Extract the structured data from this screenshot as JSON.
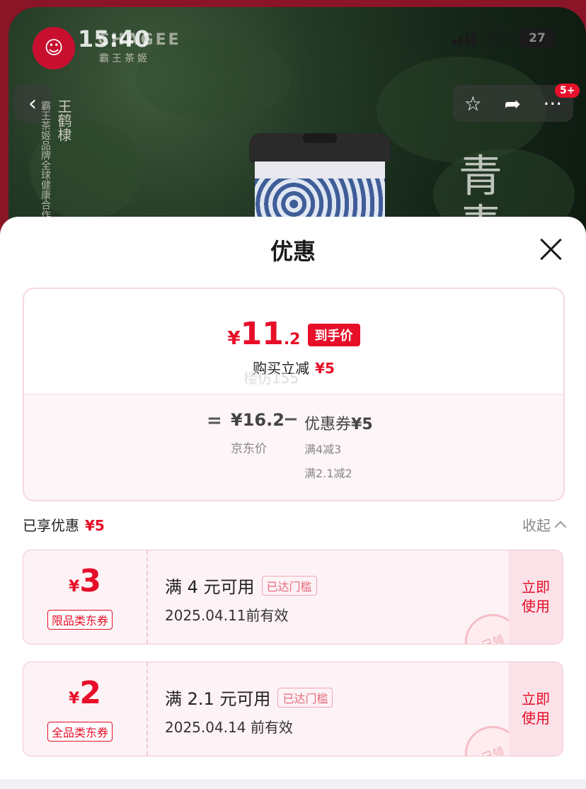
{
  "status_bar": {
    "time": "15:40",
    "network": "5G",
    "battery": "27"
  },
  "hero": {
    "brand_text": "CHAGEE",
    "brand_sub": "霸王茶姬",
    "vertical_title": "王鹤棣",
    "vertical_sub": "霸王茶姬品牌全球健康合作",
    "side_chars": [
      "青",
      "青"
    ],
    "badge": "5+"
  },
  "sheet": {
    "title": "优惠",
    "final_price": {
      "currency": "¥",
      "integer": "11",
      "decimal": ".2",
      "tag": "到手价"
    },
    "instant": {
      "label": "购买立减",
      "amount": "¥5"
    },
    "watermark": "楼仿155",
    "breakdown": {
      "equals": "=",
      "jd_price": "¥16.2",
      "jd_label": "京东价",
      "minus": "−",
      "coupon_label": "优惠券",
      "coupon_amount": "¥5",
      "rules": [
        "满4减3",
        "满2.1减2"
      ]
    },
    "enjoyed": {
      "label": "已享优惠",
      "amount": "¥5"
    },
    "collapse_label": "收起",
    "coupons": [
      {
        "currency": "¥",
        "amount": "3",
        "type": "限品类东券",
        "title": "满 4 元可用",
        "reach": "已达门槛",
        "valid": "2025.04.11前有效",
        "use_label": "立即使用",
        "stamp": "已领"
      },
      {
        "currency": "¥",
        "amount": "2",
        "type": "全品类东券",
        "title": "满 2.1 元可用",
        "reach": "已达门槛",
        "valid": "2025.04.14 前有效",
        "use_label": "立即使用",
        "stamp": "已领"
      }
    ]
  },
  "colors": {
    "accent": "#e60e28",
    "brand_red": "#8a1526",
    "coupon_bg": "#fdf2f5"
  }
}
